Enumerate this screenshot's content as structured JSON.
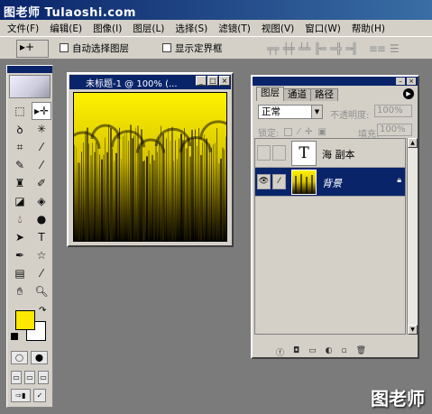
{
  "watermark": {
    "top": "图老师 Tulaoshi.com",
    "bottom": "图老师"
  },
  "menu": [
    "文件(F)",
    "编辑(E)",
    "图像(I)",
    "图层(L)",
    "选择(S)",
    "滤镜(T)",
    "视图(V)",
    "窗口(W)",
    "帮助(H)"
  ],
  "options": {
    "tool_glyph": "▸+",
    "auto_select_label": "自动选择图层",
    "show_bounds_label": "显示定界框",
    "align_icons": [
      "align-top-icon",
      "align-vcenter-icon",
      "align-bottom-icon",
      "align-left-icon",
      "align-hcenter-icon",
      "align-right-icon",
      "distribute-top-icon",
      "distribute-vcenter-icon"
    ]
  },
  "toolbox": {
    "foreground_color": "#ffe800",
    "background_color": "#ffffff",
    "tools": [
      "marquee-icon",
      "move-icon",
      "lasso-icon",
      "magic-wand-icon",
      "crop-icon",
      "slice-icon",
      "healing-icon",
      "brush-icon",
      "stamp-icon",
      "history-brush-icon",
      "eraser-icon",
      "bucket-icon",
      "blur-icon",
      "dodge-icon",
      "path-select-icon",
      "type-icon",
      "pen-icon",
      "shape-icon",
      "notes-icon",
      "eyedropper-icon",
      "hand-icon",
      "zoom-icon"
    ]
  },
  "document": {
    "title": "未标题-1 @ 100% (...",
    "controls": [
      "_",
      "□",
      "×"
    ]
  },
  "layers_panel": {
    "tabs": [
      "图层",
      "通道",
      "路径"
    ],
    "active_tab": "图层",
    "blend_mode": "正常",
    "opacity_label": "不透明度:",
    "opacity_value": "100%",
    "lock_label": "锁定:",
    "fill_label": "填充:",
    "fill_value": "100%",
    "layers": [
      {
        "name": "海 副本",
        "type": "text",
        "thumb_glyph": "T",
        "visible": false,
        "selected": false
      },
      {
        "name": "背景",
        "type": "image",
        "visible": true,
        "selected": true,
        "locked": true
      }
    ],
    "bottom_icons": [
      "layer-style-icon",
      "mask-icon",
      "new-set-icon",
      "adjustment-icon",
      "new-layer-icon",
      "trash-icon"
    ]
  },
  "colors": {
    "accent": "#0a246a",
    "panel": "#d4d0c8",
    "workspace": "#7b7b7b",
    "canvas_fg": "#ffe800"
  }
}
